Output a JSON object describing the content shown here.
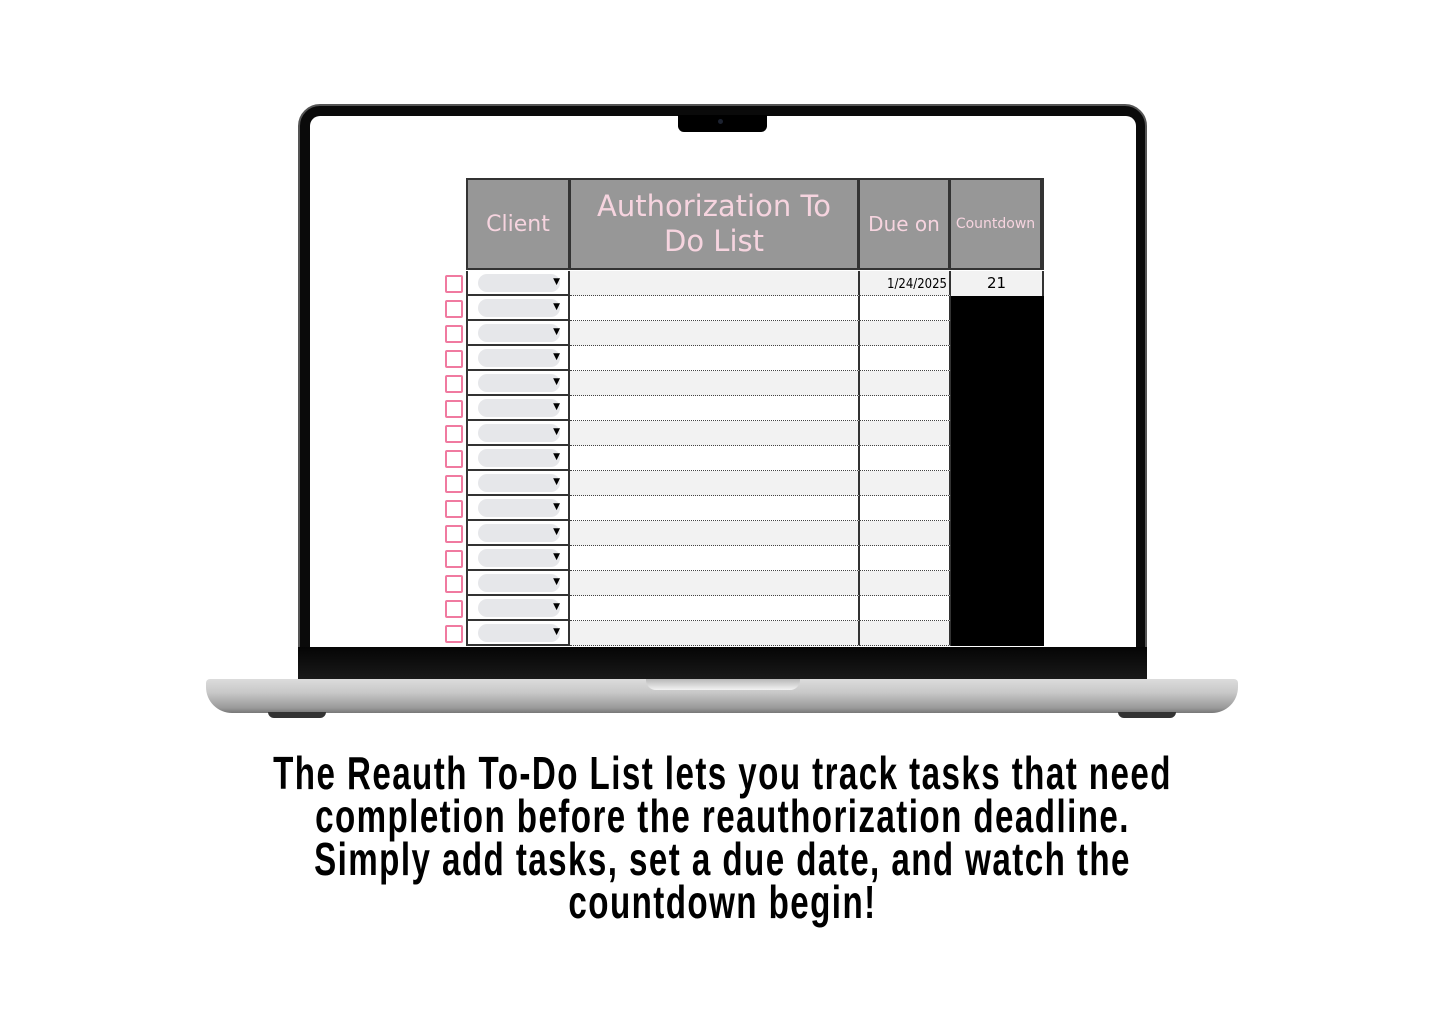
{
  "table": {
    "headers": {
      "client": "Client",
      "task_line1": "Authorization To",
      "task_line2": "Do List",
      "due": "Due on",
      "countdown": "Countdown"
    },
    "rows": [
      {
        "due": "1/24/2025",
        "countdown": "21"
      },
      {},
      {},
      {},
      {},
      {},
      {},
      {},
      {},
      {},
      {},
      {},
      {},
      {},
      {}
    ]
  },
  "caption": [
    "The Reauth To-Do List lets you track tasks that need",
    "completion before the reauthorization deadline.",
    "Simply add tasks, set a due date, and watch the",
    "countdown begin!"
  ],
  "colors": {
    "header_bg": "#979797",
    "header_text": "#f6d4df",
    "checkbox": "#f07aa0"
  }
}
